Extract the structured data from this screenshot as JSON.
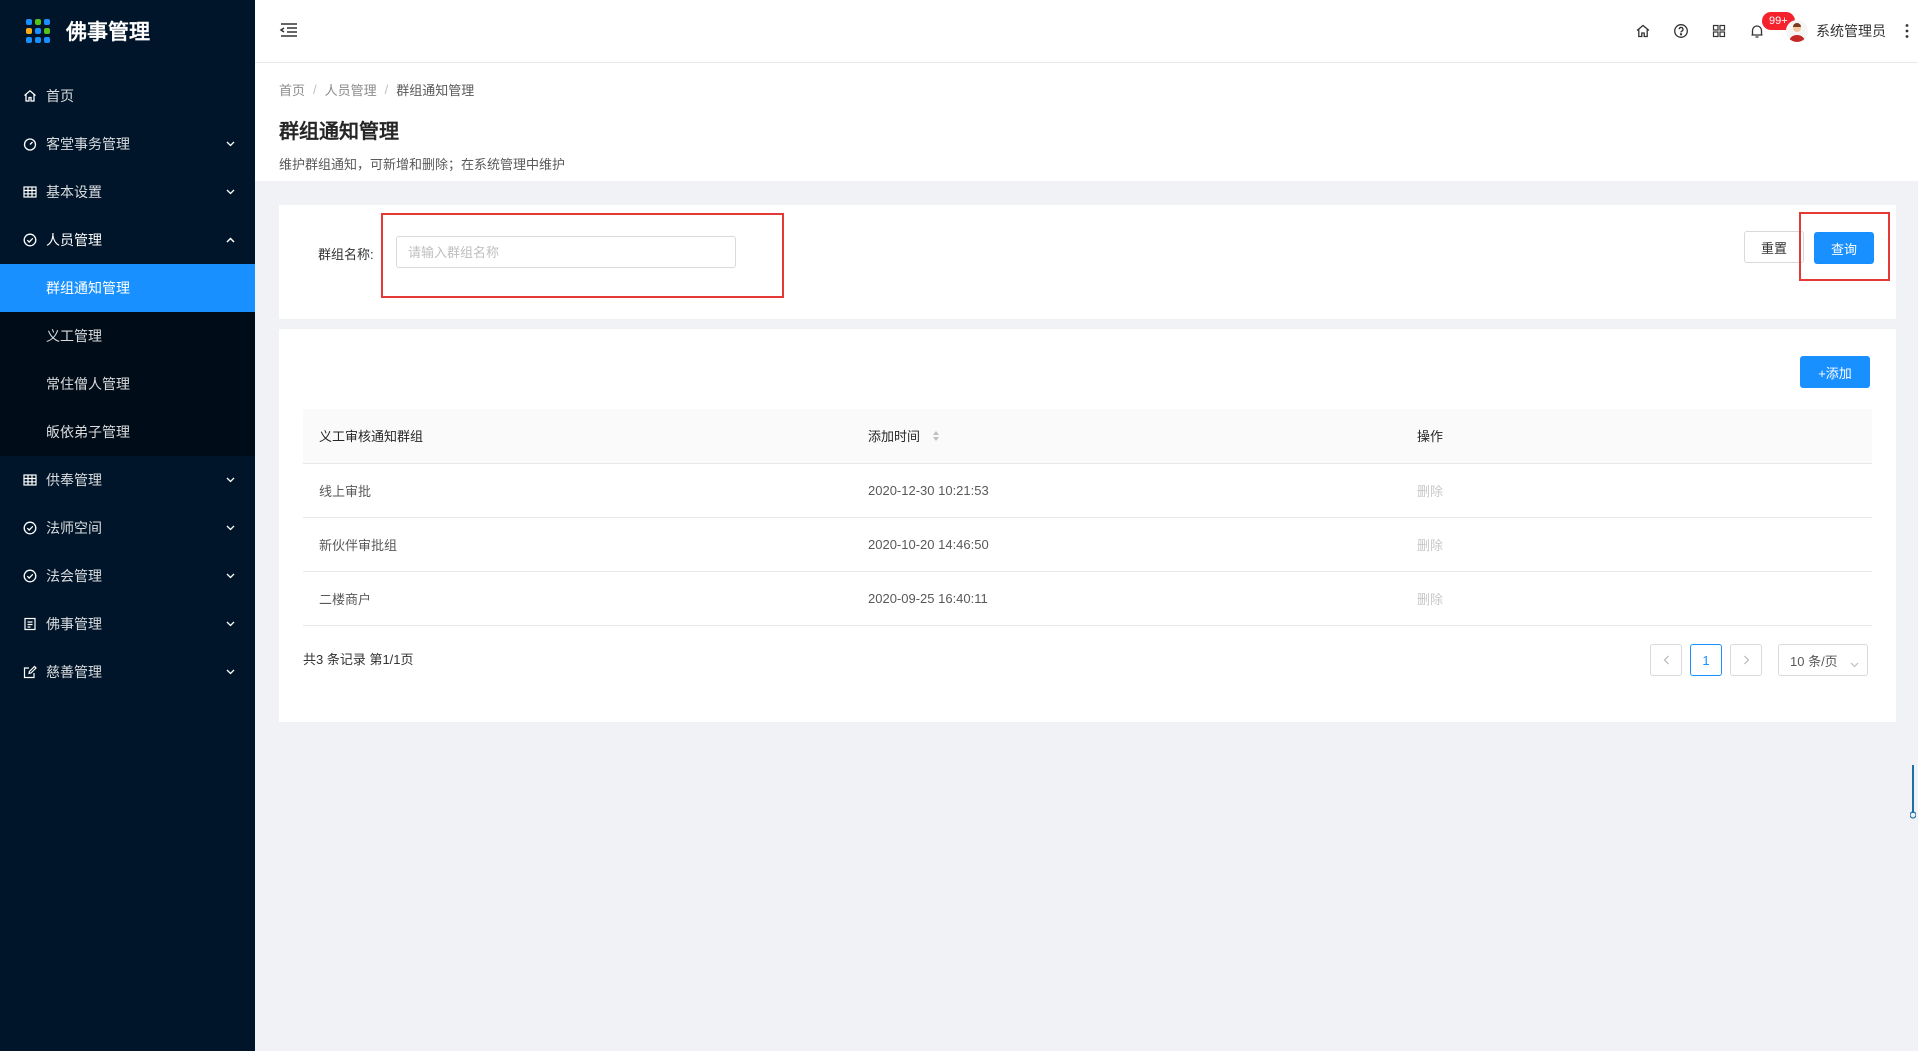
{
  "app": {
    "title": "佛事管理"
  },
  "sidebar": {
    "items": [
      {
        "label": "首页",
        "icon": "home-icon"
      },
      {
        "label": "客堂事务管理",
        "icon": "dashboard-icon"
      },
      {
        "label": "基本设置",
        "icon": "table-icon"
      },
      {
        "label": "人员管理",
        "icon": "check-circle-icon"
      },
      {
        "label": "供奉管理",
        "icon": "table-icon"
      },
      {
        "label": "法师空间",
        "icon": "check-circle-icon"
      },
      {
        "label": "法会管理",
        "icon": "check-circle-icon"
      },
      {
        "label": "佛事管理",
        "icon": "profile-icon"
      },
      {
        "label": "慈善管理",
        "icon": "form-icon"
      }
    ],
    "sub_items": [
      {
        "label": "群组通知管理"
      },
      {
        "label": "义工管理"
      },
      {
        "label": "常住僧人管理"
      },
      {
        "label": "皈依弟子管理"
      }
    ]
  },
  "header": {
    "notification_badge": "99+",
    "user_name": "系统管理员"
  },
  "breadcrumb": {
    "home": "首页",
    "parent": "人员管理",
    "current": "群组通知管理"
  },
  "page": {
    "title": "群组通知管理",
    "description": "维护群组通知，可新增和删除；在系统管理中维护"
  },
  "search": {
    "label": "群组名称:",
    "placeholder": "请输入群组名称",
    "value": "",
    "reset_label": "重置",
    "query_label": "查询"
  },
  "table": {
    "add_label": "+添加",
    "columns": [
      "义工审核通知群组",
      "添加时间",
      "操作"
    ],
    "rows": [
      {
        "name": "线上审批",
        "time": "2020-12-30 10:21:53",
        "action": "删除"
      },
      {
        "name": "新伙伴审批组",
        "time": "2020-10-20 14:46:50",
        "action": "删除"
      },
      {
        "name": "二楼商户",
        "time": "2020-09-25 16:40:11",
        "action": "删除"
      }
    ]
  },
  "pagination": {
    "total_text": "共3 条记录 第1/1页",
    "current_page": "1",
    "page_size": "10 条/页"
  },
  "colors": {
    "sidebar_bg": "#001529",
    "primary": "#1890ff",
    "highlight": "#e53935",
    "badge": "#f5222d"
  }
}
